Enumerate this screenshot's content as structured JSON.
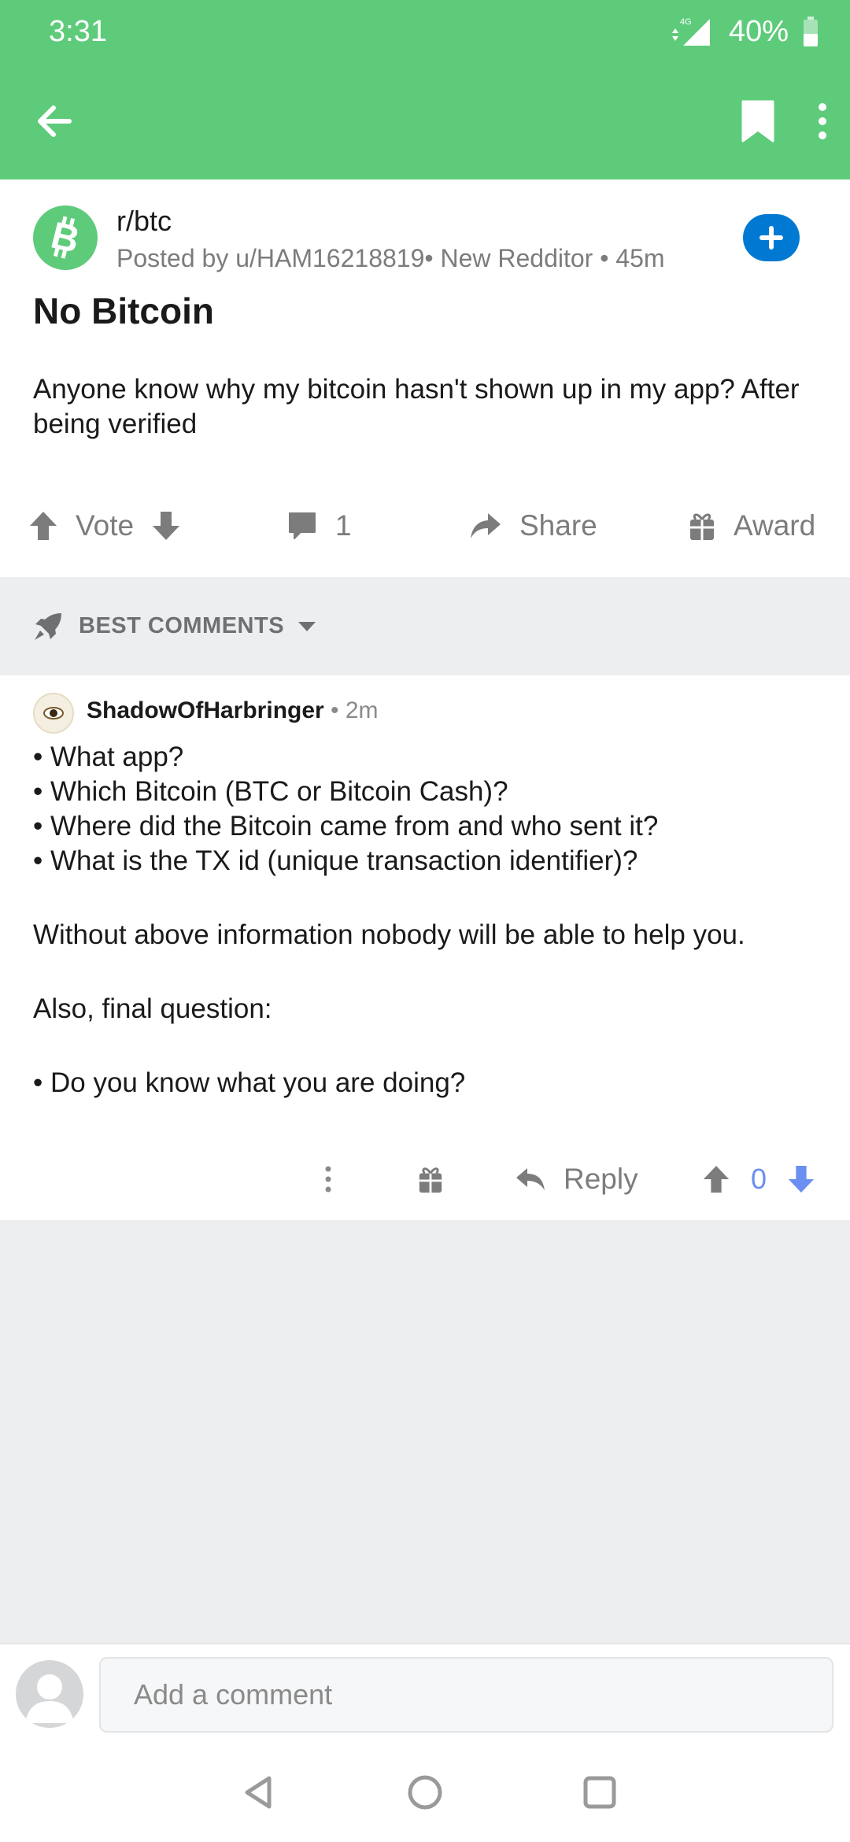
{
  "status_bar": {
    "time": "3:31",
    "network": "4G",
    "battery": "40%"
  },
  "post": {
    "subreddit": "r/btc",
    "meta": "Posted by u/HAM16218819• New Redditor • 45m",
    "title": "No Bitcoin",
    "body": "Anyone know why my bitcoin hasn't shown up in my app? After being verified",
    "vote_label": "Vote",
    "comment_count": "1",
    "share_label": "Share",
    "award_label": "Award"
  },
  "sort": {
    "label": "BEST COMMENTS"
  },
  "comment": {
    "author": "ShadowOfHarbringer",
    "time": " • 2m",
    "lines": [
      "• What app?",
      "• Which Bitcoin (BTC or Bitcoin Cash)?",
      "• Where did the Bitcoin came from and who sent it?",
      "• What is the TX id (unique transaction identifier)?",
      "Without above information nobody will be able to help you.",
      "Also, final question:",
      "• Do you know what you are doing?"
    ],
    "reply_label": "Reply",
    "score": "0"
  },
  "comment_bar": {
    "placeholder": "Add a comment"
  },
  "colors": {
    "header": "#5ecb7b",
    "join": "#0079d3",
    "downvote_active": "#6b8ff0",
    "background": "#edeef0"
  },
  "icons": [
    "back-arrow-icon",
    "bookmark-icon",
    "more-vertical-icon",
    "bitcoin-icon",
    "plus-icon",
    "upvote-icon",
    "downvote-icon",
    "comment-icon",
    "share-icon",
    "gift-icon",
    "rocket-icon",
    "caret-down-icon",
    "reply-icon",
    "user-icon",
    "back-triangle-icon",
    "home-circle-icon",
    "recents-square-icon"
  ]
}
